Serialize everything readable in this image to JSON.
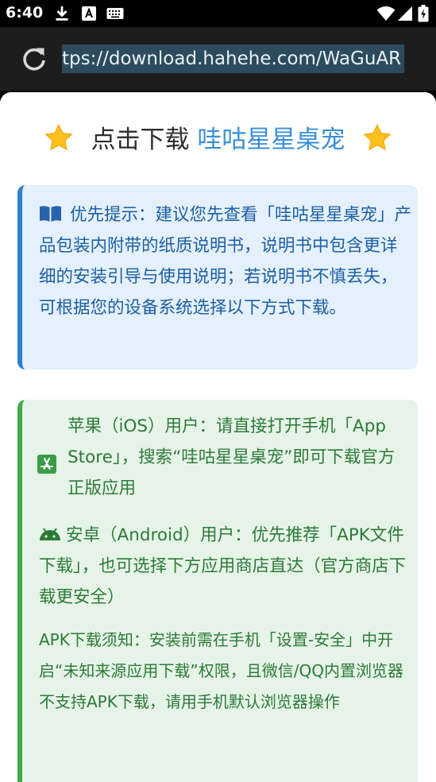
{
  "status_bar": {
    "time": "6:40",
    "icons": [
      "download-icon",
      "a-badge-icon",
      "keyboard-icon",
      "wifi-icon",
      "cell-signal-icon",
      "battery-icon"
    ]
  },
  "browser": {
    "url_display": "tps://download.hahehe.com/WaGuAR",
    "reload_icon": "reload-icon"
  },
  "page": {
    "headline_prefix": "点击下载",
    "headline_accent": "哇咕星星桌宠",
    "notice": {
      "icon": "book-icon",
      "text": "优先提示：建议您先查看「哇咕星星桌宠」产品包装内附带的纸质说明书，说明书中包含更详细的安装引导与使用说明；若说明书不慎丢失，可根据您的设备系统选择以下方式下载。"
    },
    "guide": {
      "ios_icon": "app-store-icon",
      "ios_text": "苹果（iOS）用户：请直接打开手机「App Store」，搜索“哇咕星星桌宠”即可下载官方正版应用",
      "android_icon": "android-icon",
      "android_text": "安卓（Android）用户：优先推荐「APK文件下载」，也可选择下方应用商店直达（官方商店下载更安全）",
      "apk_text": "APK下载须知：安装前需在手机「设置-安全」中开启“未知来源应用下载”权限，且微信/QQ内置浏览器不支持APK下载，请用手机默认浏览器操作"
    },
    "colors": {
      "accent_blue": "#3a8fd6",
      "notice_bg": "#e4f0fb",
      "notice_border": "#2f7fce",
      "guide_bg": "#e6f4e8",
      "guide_border": "#3faa4a",
      "guide_text": "#2d7a38"
    }
  }
}
